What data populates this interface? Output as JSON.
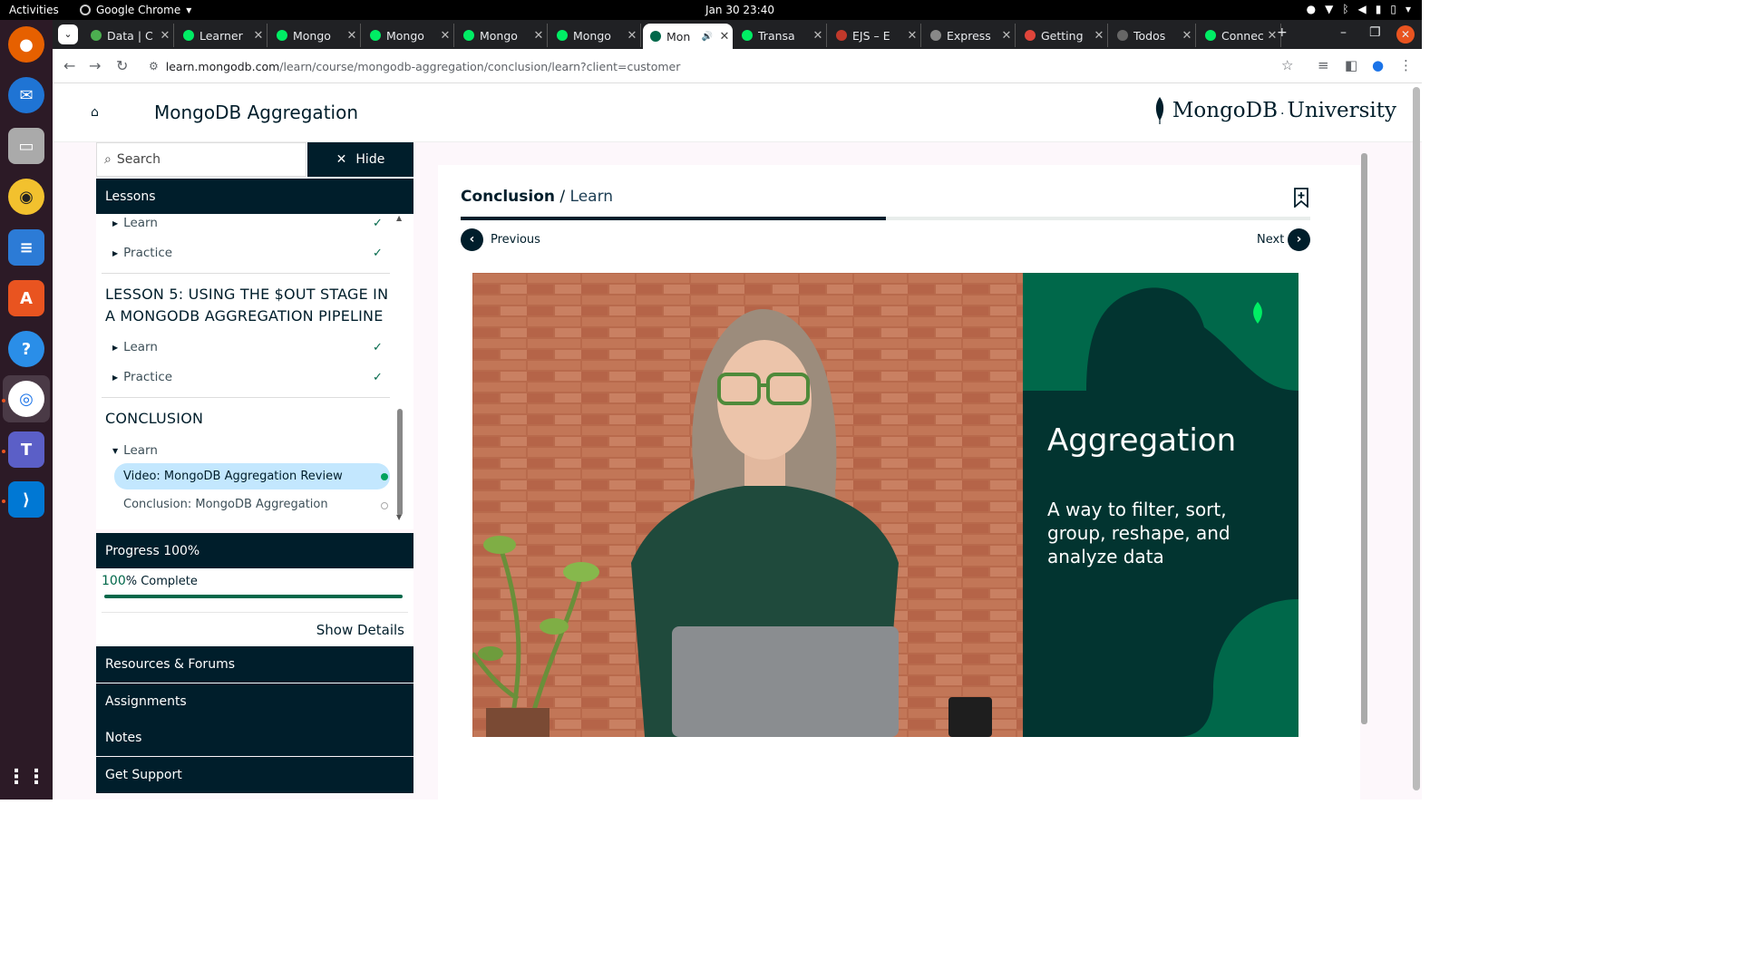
{
  "system": {
    "activities": "Activities",
    "app_name": "Google Chrome",
    "clock": "Jan 30  23:40"
  },
  "browser": {
    "tabs": [
      {
        "label": "Data | C",
        "color": "#4caf50"
      },
      {
        "label": "Learner",
        "color": "#00ed64"
      },
      {
        "label": "Mongo",
        "color": "#00ed64"
      },
      {
        "label": "Mongo",
        "color": "#00ed64"
      },
      {
        "label": "Mongo",
        "color": "#00ed64"
      },
      {
        "label": "Mongo",
        "color": "#00ed64"
      },
      {
        "label": "Mon",
        "color": "#00684a",
        "active": true
      },
      {
        "label": "Transa",
        "color": "#00ed64"
      },
      {
        "label": "EJS – E",
        "color": "#c0392b"
      },
      {
        "label": "Express",
        "color": "#888"
      },
      {
        "label": "Getting",
        "color": "#e0453b"
      },
      {
        "label": "Todos",
        "color": "#666"
      },
      {
        "label": "Connec",
        "color": "#00ed64"
      }
    ],
    "url_host": "learn.mongodb.com",
    "url_path": "/learn/course/mongodb-aggregation/conclusion/learn?client=customer"
  },
  "header": {
    "course_title": "MongoDB Aggregation",
    "logo_text": "MongoDB",
    "logo_suffix": "University"
  },
  "sidebar": {
    "search_placeholder": "Search",
    "hide_label": "Hide",
    "lessons_header": "Lessons",
    "items_top": [
      {
        "label": "Learn",
        "done": true
      },
      {
        "label": "Practice",
        "done": true
      }
    ],
    "lesson5_title": "LESSON 5: USING THE $OUT STAGE IN A MONGODB AGGREGATION PIPELINE",
    "lesson5_items": [
      {
        "label": "Learn",
        "done": true
      },
      {
        "label": "Practice",
        "done": true
      }
    ],
    "conclusion_title": "CONCLUSION",
    "conclusion_learn": "Learn",
    "active_item": "Video: MongoDB Aggregation Review",
    "pending_item": "Conclusion: MongoDB Aggregation",
    "progress_header": "Progress 100%",
    "progress_pct": "100",
    "progress_suffix": "% Complete",
    "progress_value": 1.0,
    "show_details": "Show Details",
    "sections": [
      "Resources & Forums",
      "Assignments",
      "Notes",
      "Get Support"
    ]
  },
  "main": {
    "crumb_section": "Conclusion",
    "crumb_sep": " / ",
    "crumb_page": "Learn",
    "previous_label": "Previous",
    "next_label": "Next",
    "step_progress": 0.5,
    "video_heading": "Aggregation",
    "video_desc": "A way to filter, sort, group, reshape, and analyze data"
  },
  "colors": {
    "navy": "#001e2b",
    "green": "#00684a",
    "active_item_bg": "#c3e7fe"
  }
}
